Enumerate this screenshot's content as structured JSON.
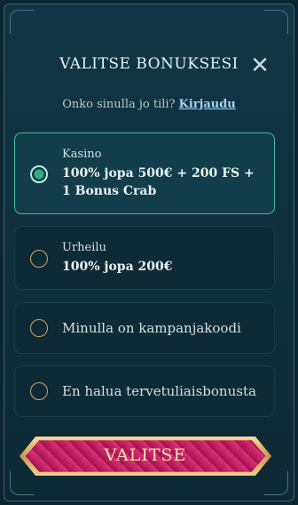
{
  "header": {
    "title": "VALITSE BONUKSESI",
    "close_symbol": "✕"
  },
  "login": {
    "question": "Onko sinulla jo tili?",
    "link": "Kirjaudu"
  },
  "options": [
    {
      "category": "Kasino",
      "offer_line1": "100% jopa 500€ + 200 FS +",
      "offer_line2": "1 Bonus Crab",
      "selected": true
    },
    {
      "category": "Urheilu",
      "offer_line1": "100% jopa 200€",
      "selected": false
    },
    {
      "label": "Minulla on kampanjakoodi",
      "selected": false
    },
    {
      "label": "En halua tervetuliaisbonusta",
      "selected": false
    }
  ],
  "cta": {
    "label": "VALITSE"
  },
  "colors": {
    "background": "#0c2531",
    "selected_border": "#3fbfa3",
    "radio_gold": "#c9a56a",
    "button_pink": "#c2185b",
    "button_gold": "#e0b56a"
  }
}
